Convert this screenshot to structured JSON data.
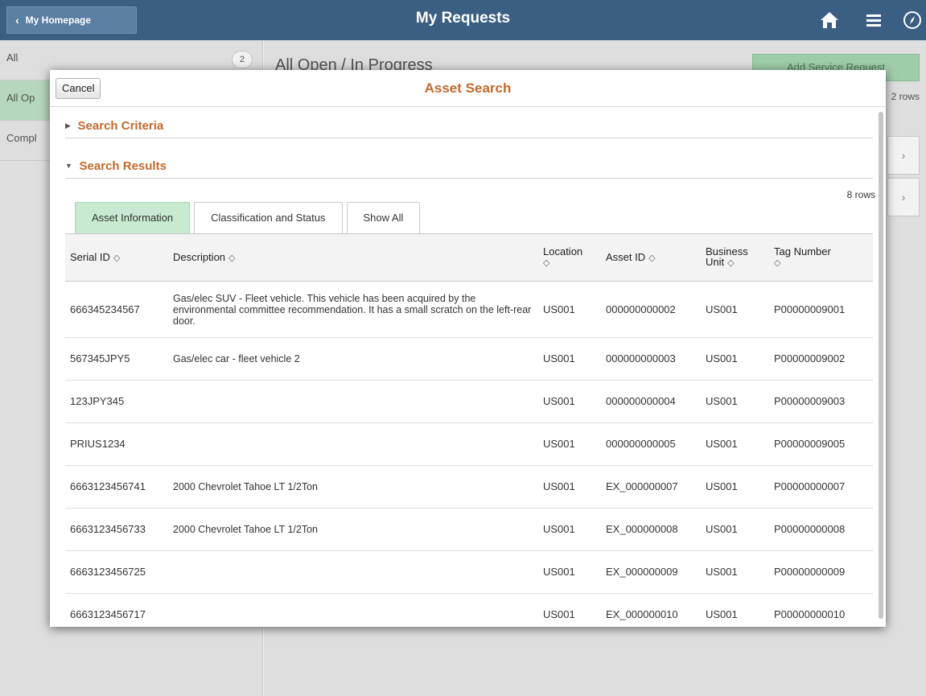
{
  "banner": {
    "back_label": "My Homepage",
    "title": "My Requests",
    "icons": [
      "home-icon",
      "menu-icon",
      "navbar-icon"
    ]
  },
  "background": {
    "left_items": [
      {
        "label": "All",
        "badge": "2"
      },
      {
        "label": "All Op"
      },
      {
        "label": "Compl"
      }
    ],
    "right_title": "All Open / In Progress",
    "add_button": "Add Service Request",
    "rows_label": "2 rows",
    "row_chevron": "›"
  },
  "modal": {
    "cancel_label": "Cancel",
    "title": "Asset Search",
    "sections": {
      "criteria": "Search Criteria",
      "results": "Search Results"
    },
    "row_count": "8 rows",
    "tabs": [
      "Asset Information",
      "Classification and Status",
      "Show All"
    ],
    "columns": {
      "serial": "Serial ID",
      "description": "Description",
      "location": "Location",
      "asset_id": "Asset ID",
      "business_unit": "Business Unit",
      "tag_number": "Tag Number"
    },
    "rows": [
      {
        "serial": "666345234567",
        "description": "Gas/elec SUV - Fleet vehicle. This vehicle has been acquired by the environmental committee recommendation. It has a small scratch on the left-rear door.",
        "location": "US001",
        "asset_id": "000000000002",
        "business_unit": "US001",
        "tag_number": "P00000009001"
      },
      {
        "serial": "567345JPY5",
        "description": "Gas/elec car - fleet vehicle 2",
        "location": "US001",
        "asset_id": "000000000003",
        "business_unit": "US001",
        "tag_number": "P00000009002"
      },
      {
        "serial": "123JPY345",
        "description": "",
        "location": "US001",
        "asset_id": "000000000004",
        "business_unit": "US001",
        "tag_number": "P00000009003"
      },
      {
        "serial": "PRIUS1234",
        "description": "",
        "location": "US001",
        "asset_id": "000000000005",
        "business_unit": "US001",
        "tag_number": "P00000009005"
      },
      {
        "serial": "6663123456741",
        "description": "2000 Chevrolet Tahoe LT 1/2Ton",
        "location": "US001",
        "asset_id": "EX_000000007",
        "business_unit": "US001",
        "tag_number": "P00000000007"
      },
      {
        "serial": "6663123456733",
        "description": "2000 Chevrolet Tahoe LT 1/2Ton",
        "location": "US001",
        "asset_id": "EX_000000008",
        "business_unit": "US001",
        "tag_number": "P00000000008"
      },
      {
        "serial": "6663123456725",
        "description": "",
        "location": "US001",
        "asset_id": "EX_000000009",
        "business_unit": "US001",
        "tag_number": "P00000000009"
      },
      {
        "serial": "6663123456717",
        "description": "",
        "location": "US001",
        "asset_id": "EX_000000010",
        "business_unit": "US001",
        "tag_number": "P00000000010"
      }
    ]
  },
  "colors": {
    "banner": "#3b5f83",
    "section_title": "#c06a2e",
    "active_tab": "#c7ead0"
  }
}
